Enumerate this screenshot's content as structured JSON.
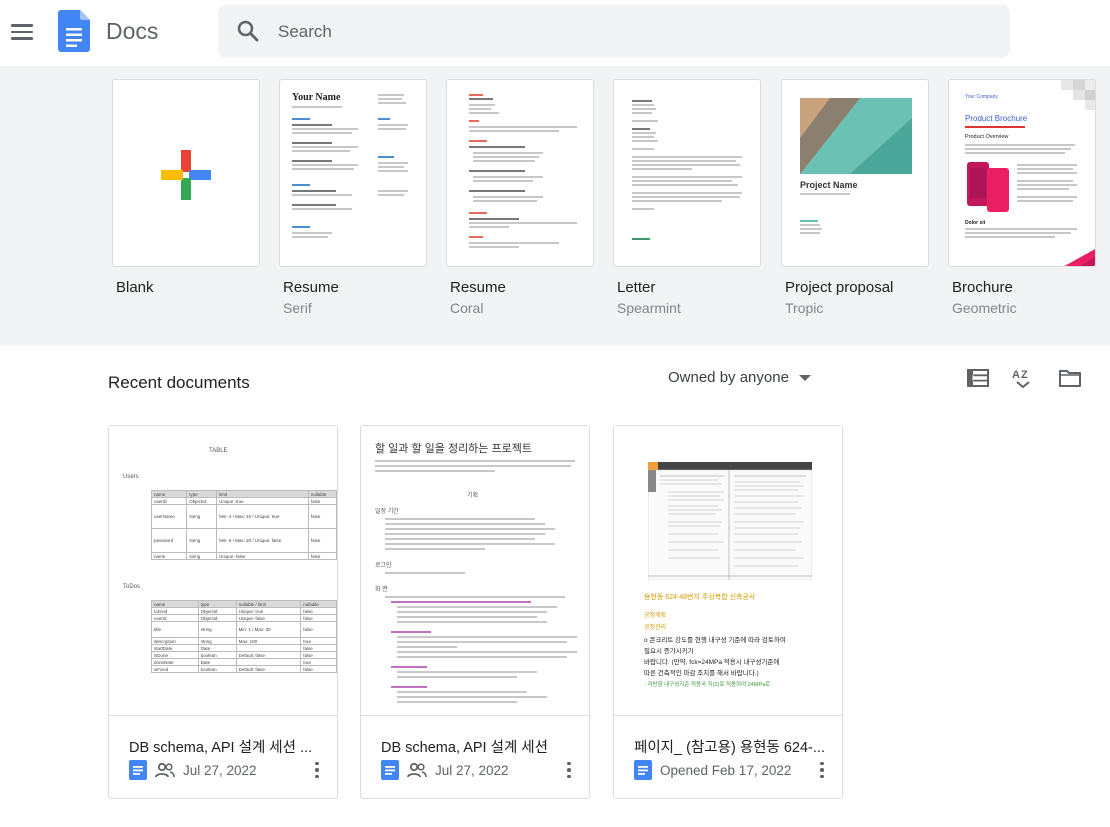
{
  "header": {
    "app_title": "Docs",
    "search": {
      "placeholder": "Search"
    }
  },
  "templates": [
    {
      "name": "Blank",
      "sub": ""
    },
    {
      "name": "Resume",
      "sub": "Serif"
    },
    {
      "name": "Resume",
      "sub": "Coral"
    },
    {
      "name": "Letter",
      "sub": "Spearmint"
    },
    {
      "name": "Project proposal",
      "sub": "Tropic"
    },
    {
      "name": "Brochure",
      "sub": "Geometric"
    }
  ],
  "thumb_text": {
    "resume_serif_name": "Your Name",
    "proposal_title": "Project Name",
    "brochure_company": "Your Company",
    "brochure_title": "Product Brochure",
    "brochure_overview": "Product Overview",
    "brochure_section": "Dolor sit"
  },
  "recent": {
    "title": "Recent documents",
    "owner_filter": "Owned by anyone",
    "docs": [
      {
        "title": "DB schema, API 설계 세션 ...",
        "date": "Jul 27, 2022",
        "shared": true
      },
      {
        "title": "DB schema, API 설계 세션",
        "date": "Jul 27, 2022",
        "shared": true
      },
      {
        "title": "페이지_ (참고용) 용현동 624-...",
        "date": "Opened Feb 17, 2022",
        "shared": false
      }
    ]
  },
  "previews": {
    "doc1": {
      "heading": "TABLE",
      "users_label": "Users",
      "users_headers": [
        "name",
        "type",
        "limit",
        "nullable"
      ],
      "users_rows": [
        [
          "userId",
          "ObjectId",
          "Unique: true",
          "false"
        ],
        [
          "userName",
          "string",
          "Min: 4 / Max: 10 / Unique: true",
          "false"
        ],
        [
          "password",
          "string",
          "Min: 6 / Max: 20 / Unique: false",
          "false"
        ],
        [
          "name",
          "string",
          "Unique: false",
          "false"
        ]
      ],
      "todos_label": "ToDos",
      "todos_headers": [
        "name",
        "type",
        "nullable / limit",
        "nullable"
      ],
      "todos_rows": [
        [
          "toDoId",
          "ObjectId",
          "Unique: true",
          "false"
        ],
        [
          "userId",
          "ObjectId",
          "Unique: false",
          "false"
        ],
        [
          "title",
          "string",
          "Min: 1 / Max: 30",
          "false"
        ],
        [
          "description",
          "string",
          "Max: 100",
          "true"
        ],
        [
          "startDate",
          "Date",
          "",
          "false"
        ],
        [
          "isDone",
          "boolean",
          "Default: false",
          "false"
        ],
        [
          "doneDate",
          "Date",
          "",
          "true"
        ],
        [
          "isFixed",
          "boolean",
          "Default: false",
          "false"
        ]
      ]
    },
    "doc2": {
      "heading": "할 일과 할 일을 정리하는 프로젝트",
      "section": "기획",
      "sub1": "일정 기간",
      "sub2": "로그인",
      "sub3": "화 면"
    },
    "doc3": {
      "headline": "용현동 624-48번지 주상복합 신축공사",
      "line1": "공정계획",
      "line2": "공정관리",
      "body1": "o 콘크리트 강도를 현행 내구성 기준에 따라 검토하여",
      "body2": "필요시 증가시키기",
      "body3": "바랍니다. (만약, fck=24MPa 적용시 내구성기준에",
      "body4": "따른 건축적인 마감 조치를 해서 바랍니다.)",
      "body5": "- 저방향 내구성기준 적용국 지(2)로 적용하여 24MPa로"
    }
  }
}
